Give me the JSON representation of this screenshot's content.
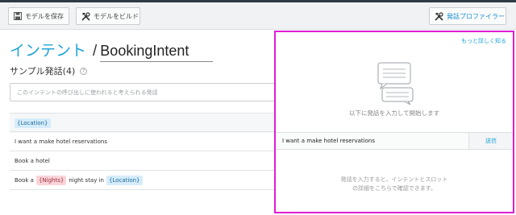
{
  "toolbar": {
    "save_label": "モデルを保存",
    "build_label": "モデルをビルド",
    "profiler_label": "発話プロファイラー"
  },
  "intent": {
    "heading": "インテント",
    "separator": "/",
    "name": "BookingIntent"
  },
  "sample_utterances": {
    "heading": "サンプル発話(4)",
    "input_placeholder": "このインテントの呼び出しに使われると考えられる発話",
    "rows": [
      {
        "parts": [
          {
            "type": "slot",
            "text": "{Location}",
            "slot": "loc"
          }
        ]
      },
      {
        "parts": [
          {
            "type": "text",
            "text": "I want a make hotel reservations"
          }
        ]
      },
      {
        "parts": [
          {
            "type": "text",
            "text": "Book a hotel"
          }
        ]
      },
      {
        "parts": [
          {
            "type": "text",
            "text": "Book a"
          },
          {
            "type": "slot",
            "text": "{Nights}",
            "slot": "nights"
          },
          {
            "type": "text",
            "text": "night stay in"
          },
          {
            "type": "slot",
            "text": "{Location}",
            "slot": "loc"
          }
        ]
      }
    ]
  },
  "profiler_panel": {
    "learn_more": "もっと詳しく知る",
    "start_message": "以下に発話を入力して開始します",
    "test_input_value": "I want a make hotel reservations",
    "send_label": "送信",
    "hint_line1": "発話を入力すると、インテントとスロット",
    "hint_line2": "の詳細をこちらで確認できます。"
  },
  "colors": {
    "accent": "#1ea3d9",
    "highlight_border": "#e01dd6",
    "slot_location_bg": "#d6ecfa",
    "slot_nights_bg": "#f9d4d8"
  },
  "icons": {
    "save": "save-icon",
    "build": "tools-icon",
    "profiler": "tools-icon",
    "chat": "chat-bubbles-icon",
    "help": "help-icon"
  }
}
